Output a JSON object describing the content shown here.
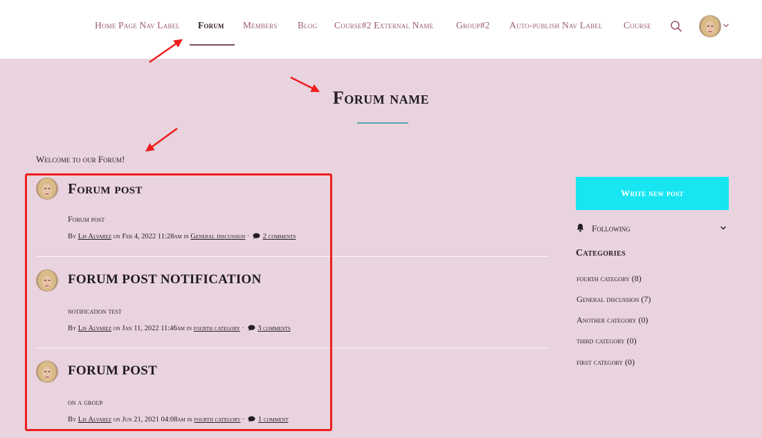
{
  "nav": {
    "items": [
      {
        "label": "Home Page Nav Label"
      },
      {
        "label": "Forum"
      },
      {
        "label": "Members"
      },
      {
        "label": "Blog"
      },
      {
        "label": "Course#2 External Name"
      },
      {
        "label": "Group#2"
      },
      {
        "label": "Auto-publish Nav Label"
      },
      {
        "label": "Course"
      }
    ],
    "active": "Forum"
  },
  "page": {
    "title": "Forum name",
    "welcome": "Welcome to our Forum!"
  },
  "posts": [
    {
      "title": "Forum post",
      "excerpt": "Forum post",
      "by": "By",
      "author": "Lis Alvarez",
      "on": "on Feb 4, 2022 11:28am in",
      "category": "General discussion",
      "sep": "·",
      "comments": "2 comments"
    },
    {
      "title": "FORUM POST NOTIFICATION",
      "excerpt": "notification test",
      "by": "By",
      "author": "Lis Alvarez",
      "on": "on Jan 11, 2022 11:46am in",
      "category": "fourth category",
      "sep": "·",
      "comments": "3 comments"
    },
    {
      "title": "FORUM POST",
      "excerpt": "on a group",
      "by": "By",
      "author": "Lis Alvarez",
      "on": "on Jun 21, 2021 04:08am in",
      "category": "fourth category",
      "sep": "·",
      "comments": "1 comment"
    }
  ],
  "sidebar": {
    "write_button": "Write new post",
    "following": "Following",
    "categories_heading": "Categories",
    "categories": [
      {
        "label": "fourth category (8)"
      },
      {
        "label": "General discussion (7)"
      },
      {
        "label": "Another category (0)"
      },
      {
        "label": "third category (0)"
      },
      {
        "label": "first category (0)"
      }
    ]
  },
  "colors": {
    "background": "#e8d3de",
    "header": "#ffffff",
    "nav_text": "#9b5b6d",
    "accent_button": "#17e6f2",
    "title_rule": "#5aa3ad",
    "annotation": "#ee1c1c"
  },
  "icons": {
    "search": "search-icon",
    "bell": "bell-icon",
    "comment": "comment-icon",
    "chevron": "chevron-down-icon"
  }
}
